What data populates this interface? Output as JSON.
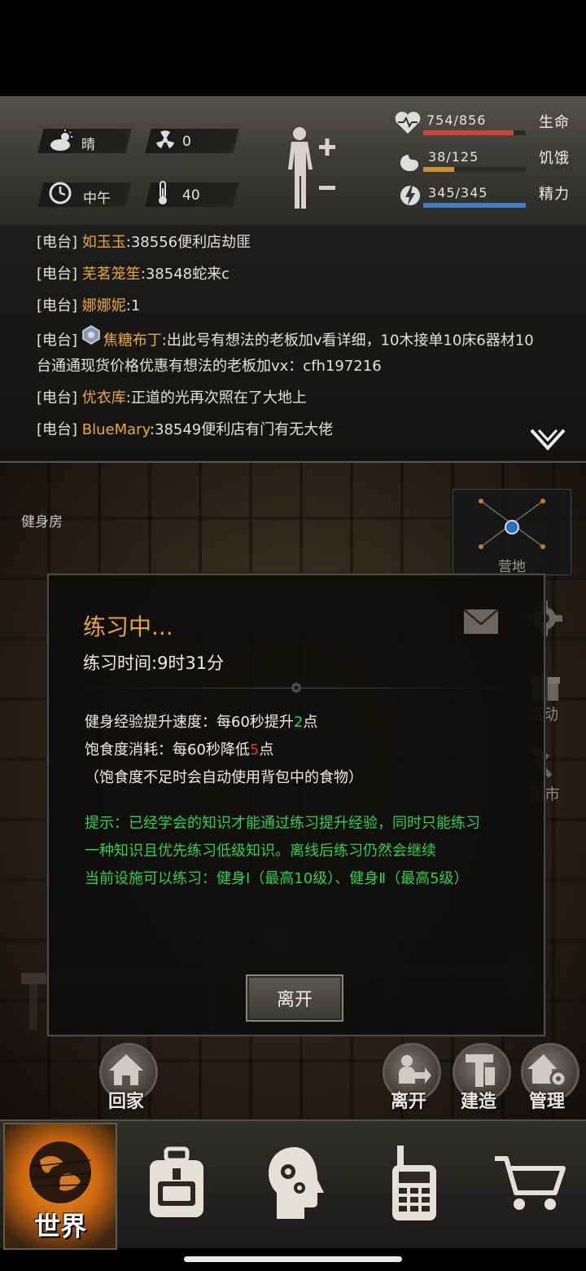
{
  "status": {
    "weather": "晴",
    "radiation": "0",
    "time_of_day": "中午",
    "temperature": "40",
    "life": {
      "label": "生命",
      "value": "754/856",
      "fraction": 0.881,
      "color": "#c8463a"
    },
    "hunger": {
      "label": "饥饿",
      "value": "38/125",
      "fraction": 0.304,
      "color": "#c8902e"
    },
    "energy": {
      "label": "精力",
      "value": "345/345",
      "fraction": 1.0,
      "color": "#3d7fc4"
    }
  },
  "chat": {
    "lines": [
      {
        "tag": "[电台]",
        "name": "如玉玉",
        "msg": ":38556便利店劫匪"
      },
      {
        "tag": "[电台]",
        "name": "芜茗笼笙",
        "msg": ":38548蛇来c"
      },
      {
        "tag": "[电台]",
        "name": "娜娜妮",
        "msg": ":1"
      },
      {
        "tag": "[电台]",
        "name": "焦糖布丁",
        "msg": ":出此号有想法的老板加v看详细，10木接单10床6器材10",
        "cont": "台通通现货价格优惠有想法的老板加vx：cfh197216"
      },
      {
        "tag": "[电台]",
        "name": "优衣库",
        "msg": ":正道的光再次照在了大地上"
      },
      {
        "tag": "[电台]",
        "name": "BlueMary",
        "msg": ":38549便利店有门有无大佬"
      }
    ]
  },
  "scene": {
    "location": "健身房",
    "minimap_label": "营地",
    "side_buttons": {
      "activity": "活动",
      "market": "集市"
    }
  },
  "dialog": {
    "title": "练习中...",
    "time_label": "练习时间:9时31分",
    "exp_prefix": "健身经验提升速度：每60秒提升",
    "exp_value": "2",
    "exp_suffix": "点",
    "hunger_prefix": "饱食度消耗：每60秒降低",
    "hunger_value": "5",
    "hunger_suffix": "点",
    "note": "（饱食度不足时会自动使用背包中的食物）",
    "tip1": "提示：已经学会的知识才能通过练习提升经验，同时只能练习",
    "tip2": "一种知识且优先练习低级知识。离线后练习仍然会继续",
    "tip3": "当前设施可以练习：健身Ⅰ（最高10级）、健身Ⅱ（最高5级）",
    "leave_button": "离开"
  },
  "actions": {
    "home": "回家",
    "leave": "离开",
    "build": "建造",
    "manage": "管理"
  },
  "nav": {
    "world": "世界"
  }
}
